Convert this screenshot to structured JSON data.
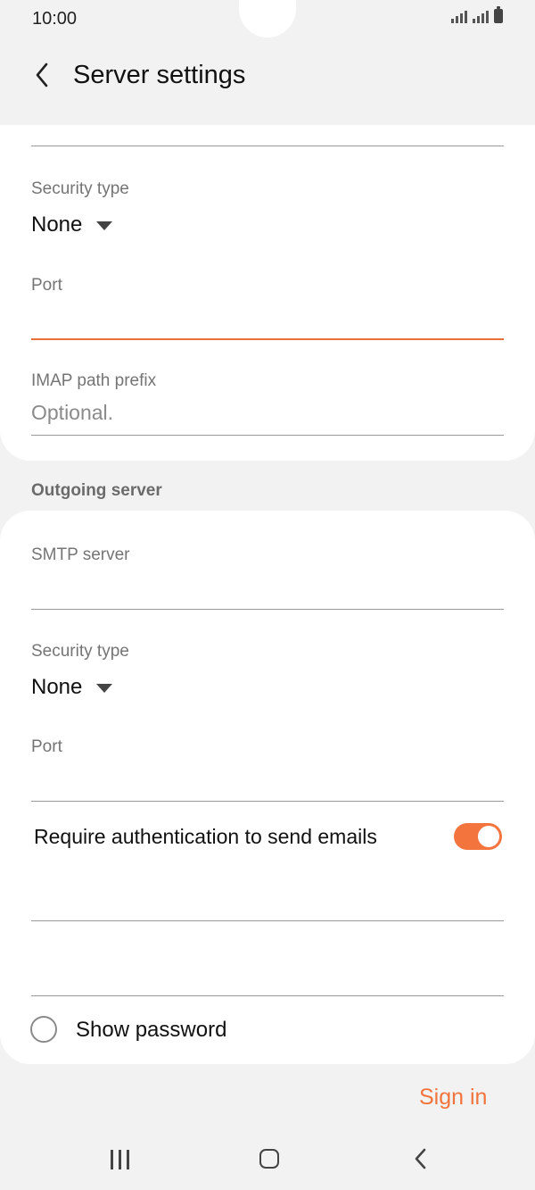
{
  "status": {
    "time": "10:00"
  },
  "header": {
    "title": "Server settings"
  },
  "incoming": {
    "security_label": "Security type",
    "security_value": "None",
    "port_label": "Port",
    "port_value": "",
    "imap_label": "IMAP path prefix",
    "imap_placeholder": "Optional."
  },
  "outgoing": {
    "section_title": "Outgoing server",
    "smtp_label": "SMTP server",
    "smtp_value": "",
    "security_label": "Security type",
    "security_value": "None",
    "port_label": "Port",
    "port_value": "",
    "auth_label": "Require authentication to send emails",
    "auth_enabled": true,
    "show_password_label": "Show password",
    "show_password_checked": false
  },
  "actions": {
    "sign_in": "Sign in"
  },
  "colors": {
    "accent": "#f2743d",
    "background": "#f2f2f2"
  }
}
